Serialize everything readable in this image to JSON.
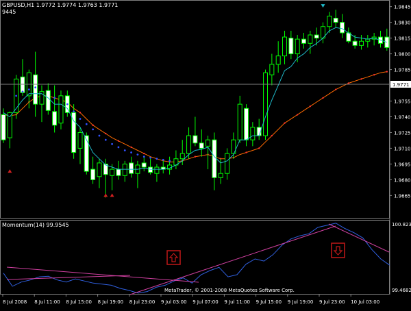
{
  "main": {
    "header_line1": "GBPUSD,H1  1.9772 1.9774 1.9763 1.9771",
    "header_line2": "9445",
    "price_min": 1.9645,
    "price_max": 1.985,
    "price_ticks": [
      "1.9845",
      "1.9830",
      "1.9815",
      "1.9800",
      "1.9785",
      "1.9771",
      "1.9755",
      "1.9740",
      "1.9725",
      "1.9710",
      "1.9695",
      "1.9680",
      "1.9665"
    ],
    "current_price": "1.9771",
    "candles": [
      {
        "o": 1.9742,
        "h": 1.9748,
        "l": 1.9715,
        "c": 1.9718
      },
      {
        "o": 1.972,
        "h": 1.9745,
        "l": 1.971,
        "c": 1.9744
      },
      {
        "o": 1.9744,
        "h": 1.978,
        "l": 1.9738,
        "c": 1.9776
      },
      {
        "o": 1.9778,
        "h": 1.9795,
        "l": 1.976,
        "c": 1.9763
      },
      {
        "o": 1.976,
        "h": 1.9785,
        "l": 1.9748,
        "c": 1.9782
      },
      {
        "o": 1.978,
        "h": 1.9802,
        "l": 1.974,
        "c": 1.9752
      },
      {
        "o": 1.9752,
        "h": 1.977,
        "l": 1.9735,
        "c": 1.9764
      },
      {
        "o": 1.9765,
        "h": 1.9772,
        "l": 1.9742,
        "c": 1.9746
      },
      {
        "o": 1.9745,
        "h": 1.977,
        "l": 1.9725,
        "c": 1.9732
      },
      {
        "o": 1.9734,
        "h": 1.9765,
        "l": 1.9728,
        "c": 1.976
      },
      {
        "o": 1.976,
        "h": 1.9765,
        "l": 1.974,
        "c": 1.9744
      },
      {
        "o": 1.9744,
        "h": 1.9752,
        "l": 1.97,
        "c": 1.9706
      },
      {
        "o": 1.971,
        "h": 1.973,
        "l": 1.9695,
        "c": 1.9725
      },
      {
        "o": 1.9722,
        "h": 1.9725,
        "l": 1.9685,
        "c": 1.9688
      },
      {
        "o": 1.969,
        "h": 1.9702,
        "l": 1.9676,
        "c": 1.968
      },
      {
        "o": 1.9683,
        "h": 1.97,
        "l": 1.9672,
        "c": 1.9696
      },
      {
        "o": 1.9695,
        "h": 1.97,
        "l": 1.9663,
        "c": 1.9685
      },
      {
        "o": 1.9684,
        "h": 1.9695,
        "l": 1.967,
        "c": 1.969
      },
      {
        "o": 1.969,
        "h": 1.9698,
        "l": 1.968,
        "c": 1.9684
      },
      {
        "o": 1.9684,
        "h": 1.9698,
        "l": 1.9678,
        "c": 1.9695
      },
      {
        "o": 1.9696,
        "h": 1.9702,
        "l": 1.9682,
        "c": 1.9686
      },
      {
        "o": 1.9686,
        "h": 1.9698,
        "l": 1.9672,
        "c": 1.9694
      },
      {
        "o": 1.9696,
        "h": 1.9702,
        "l": 1.9688,
        "c": 1.9692
      },
      {
        "o": 1.9692,
        "h": 1.97,
        "l": 1.9685,
        "c": 1.9687
      },
      {
        "o": 1.9686,
        "h": 1.9695,
        "l": 1.9678,
        "c": 1.9692
      },
      {
        "o": 1.9692,
        "h": 1.9698,
        "l": 1.9686,
        "c": 1.969
      },
      {
        "o": 1.969,
        "h": 1.9702,
        "l": 1.9685,
        "c": 1.9694
      },
      {
        "o": 1.9694,
        "h": 1.9708,
        "l": 1.969,
        "c": 1.97
      },
      {
        "o": 1.97,
        "h": 1.9718,
        "l": 1.9694,
        "c": 1.9705
      },
      {
        "o": 1.9705,
        "h": 1.973,
        "l": 1.97,
        "c": 1.9722
      },
      {
        "o": 1.9722,
        "h": 1.974,
        "l": 1.9712,
        "c": 1.9715
      },
      {
        "o": 1.9715,
        "h": 1.9728,
        "l": 1.9702,
        "c": 1.971
      },
      {
        "o": 1.9712,
        "h": 1.9722,
        "l": 1.969,
        "c": 1.9718
      },
      {
        "o": 1.9718,
        "h": 1.9725,
        "l": 1.967,
        "c": 1.9682
      },
      {
        "o": 1.9682,
        "h": 1.97,
        "l": 1.9676,
        "c": 1.9686
      },
      {
        "o": 1.9686,
        "h": 1.971,
        "l": 1.968,
        "c": 1.9705
      },
      {
        "o": 1.9705,
        "h": 1.9725,
        "l": 1.97,
        "c": 1.9718
      },
      {
        "o": 1.9718,
        "h": 1.976,
        "l": 1.9715,
        "c": 1.9752
      },
      {
        "o": 1.9748,
        "h": 1.9752,
        "l": 1.9712,
        "c": 1.9718
      },
      {
        "o": 1.9718,
        "h": 1.9735,
        "l": 1.9712,
        "c": 1.973
      },
      {
        "o": 1.973,
        "h": 1.9738,
        "l": 1.9718,
        "c": 1.9722
      },
      {
        "o": 1.9722,
        "h": 1.9785,
        "l": 1.9718,
        "c": 1.9782
      },
      {
        "o": 1.978,
        "h": 1.98,
        "l": 1.977,
        "c": 1.979
      },
      {
        "o": 1.979,
        "h": 1.9812,
        "l": 1.9782,
        "c": 1.9798
      },
      {
        "o": 1.9798,
        "h": 1.9822,
        "l": 1.979,
        "c": 1.9816
      },
      {
        "o": 1.9815,
        "h": 1.9822,
        "l": 1.9795,
        "c": 1.98
      },
      {
        "o": 1.98,
        "h": 1.9818,
        "l": 1.9792,
        "c": 1.9814
      },
      {
        "o": 1.9814,
        "h": 1.982,
        "l": 1.9805,
        "c": 1.981
      },
      {
        "o": 1.981,
        "h": 1.9822,
        "l": 1.98,
        "c": 1.9818
      },
      {
        "o": 1.9818,
        "h": 1.9825,
        "l": 1.9808,
        "c": 1.9815
      },
      {
        "o": 1.9815,
        "h": 1.983,
        "l": 1.981,
        "c": 1.9826
      },
      {
        "o": 1.9826,
        "h": 1.984,
        "l": 1.982,
        "c": 1.9836
      },
      {
        "o": 1.9834,
        "h": 1.9842,
        "l": 1.9825,
        "c": 1.983
      },
      {
        "o": 1.983,
        "h": 1.9838,
        "l": 1.9815,
        "c": 1.982
      },
      {
        "o": 1.982,
        "h": 1.9825,
        "l": 1.981,
        "c": 1.9812
      },
      {
        "o": 1.9812,
        "h": 1.9818,
        "l": 1.9805,
        "c": 1.9808
      },
      {
        "o": 1.9808,
        "h": 1.9818,
        "l": 1.9804,
        "c": 1.9812
      },
      {
        "o": 1.9812,
        "h": 1.9818,
        "l": 1.9806,
        "c": 1.9814
      },
      {
        "o": 1.9814,
        "h": 1.982,
        "l": 1.9808,
        "c": 1.9816
      },
      {
        "o": 1.9816,
        "h": 1.9822,
        "l": 1.9806,
        "c": 1.981
      },
      {
        "o": 1.9816,
        "h": 1.9824,
        "l": 1.9803,
        "c": 1.9806
      }
    ],
    "ma_fast": [
      1.9744,
      1.974,
      1.9748,
      1.9756,
      1.9762,
      1.9762,
      1.9762,
      1.9758,
      1.9752,
      1.9752,
      1.9748,
      1.9736,
      1.973,
      1.9718,
      1.9706,
      1.97,
      1.9694,
      1.9692,
      1.969,
      1.969,
      1.969,
      1.969,
      1.9691,
      1.969,
      1.969,
      1.969,
      1.9691,
      1.9694,
      1.9698,
      1.9704,
      1.9708,
      1.9709,
      1.9711,
      1.9702,
      1.9696,
      1.9698,
      1.9704,
      1.9718,
      1.9718,
      1.9722,
      1.9722,
      1.974,
      1.9756,
      1.977,
      1.9784,
      1.9788,
      1.9796,
      1.98,
      1.9806,
      1.981,
      1.9815,
      1.9822,
      1.9825,
      1.9824,
      1.982,
      1.9816,
      1.9815,
      1.9814,
      1.9815,
      1.9813,
      1.9811
    ],
    "ma_slow": [
      1.9742,
      1.9741,
      1.9742,
      1.9748,
      1.9754,
      1.9758,
      1.976,
      1.976,
      1.9758,
      1.9756,
      1.9754,
      1.9748,
      1.9744,
      1.9738,
      1.9732,
      1.9728,
      1.9724,
      1.972,
      1.9717,
      1.9714,
      1.9711,
      1.9708,
      1.9705,
      1.9702,
      1.97,
      1.9698,
      1.9697,
      1.9697,
      1.9698,
      1.97,
      1.9702,
      1.9703,
      1.9704,
      1.9702,
      1.97,
      1.97,
      1.9701,
      1.9704,
      1.9706,
      1.9708,
      1.971,
      1.9716,
      1.9722,
      1.9728,
      1.9734,
      1.9738,
      1.9742,
      1.9746,
      1.975,
      1.9754,
      1.9758,
      1.9762,
      1.9766,
      1.9769,
      1.9772,
      1.9774,
      1.9776,
      1.9778,
      1.978,
      1.9782,
      1.9783
    ],
    "sar_dots": [
      {
        "i": 2,
        "v": 1.976
      },
      {
        "i": 3,
        "v": 1.9764
      },
      {
        "i": 4,
        "v": 1.9766
      },
      {
        "i": 5,
        "v": 1.9768
      },
      {
        "i": 8,
        "v": 1.9758
      },
      {
        "i": 10,
        "v": 1.9752
      },
      {
        "i": 11,
        "v": 1.9745
      },
      {
        "i": 12,
        "v": 1.9738
      },
      {
        "i": 13,
        "v": 1.9733
      },
      {
        "i": 14,
        "v": 1.9728
      },
      {
        "i": 15,
        "v": 1.9722
      },
      {
        "i": 16,
        "v": 1.9718
      },
      {
        "i": 17,
        "v": 1.9714
      },
      {
        "i": 18,
        "v": 1.9711
      },
      {
        "i": 19,
        "v": 1.9708
      },
      {
        "i": 20,
        "v": 1.9706
      },
      {
        "i": 21,
        "v": 1.9704
      },
      {
        "i": 22,
        "v": 1.9702
      },
      {
        "i": 23,
        "v": 1.9701
      },
      {
        "i": 24,
        "v": 1.97
      },
      {
        "i": 25,
        "v": 1.9699
      },
      {
        "i": 26,
        "v": 1.9698
      }
    ],
    "arrows_up": [
      {
        "i": 1,
        "v": 1.9688
      },
      {
        "i": 16,
        "v": 1.9665
      },
      {
        "i": 17,
        "v": 1.9665
      }
    ],
    "arrows_down": [
      {
        "i": 50,
        "v": 1.9846
      }
    ]
  },
  "indicator": {
    "title": "Momentum(14) 99.9545",
    "min": 99.4682,
    "max": 100.8236,
    "tick_top": "100.8236",
    "tick_bottom": "99.4682",
    "values": [
      99.85,
      99.6,
      99.68,
      99.72,
      99.78,
      99.79,
      99.72,
      99.68,
      99.74,
      99.7,
      99.66,
      99.64,
      99.62,
      99.56,
      99.52,
      99.47,
      99.5,
      99.58,
      99.62,
      99.7,
      99.76,
      99.66,
      99.82,
      99.9,
      99.96,
      99.78,
      99.82,
      100.02,
      100.12,
      100.08,
      100.2,
      100.38,
      100.5,
      100.56,
      100.6,
      100.72,
      100.76,
      100.8,
      100.7,
      100.62,
      100.52,
      100.3,
      100.12,
      100.0
    ]
  },
  "time_axis": [
    "8 Jul 2008",
    "8 Jul 11:00",
    "8 Jul 15:00",
    "8 Jul 19:00",
    "8 Jul 23:00",
    "9 Jul 03:00",
    "9 Jul 07:00",
    "9 Jul 11:00",
    "9 Jul 15:00",
    "9 Jul 19:00",
    "9 Jul 23:00",
    "10 Jul 03:00"
  ],
  "copyright": "MetaTrader, © 2001-2008 MetaQuotes Software Corp.",
  "colors": {
    "bull": "#000000",
    "bear": "#ffffff",
    "wick": "#00ff00",
    "ma_fast": "#1fb8c8",
    "ma_slow": "#ff6a00",
    "sar": "#3050ff",
    "momentum": "#3060e0",
    "trendline": "#d040a0",
    "signal_box": "#c01818",
    "grid": "#808080"
  }
}
